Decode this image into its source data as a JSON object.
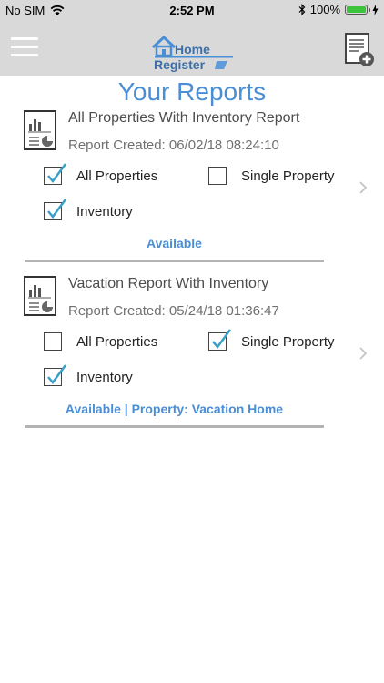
{
  "status_bar": {
    "carrier": "No SIM",
    "time": "2:52 PM",
    "battery_percent": "100%"
  },
  "header": {
    "logo_text_top": "Home",
    "logo_text_bottom": "Register",
    "logo_color": "#4a8ed6"
  },
  "page": {
    "title": "Your Reports"
  },
  "reports": [
    {
      "title": "All Properties With Inventory Report",
      "created": "Report Created: 06/02/18 08:24:10",
      "options": [
        {
          "label": "All Properties",
          "checked": true
        },
        {
          "label": "Single Property",
          "checked": false
        },
        {
          "label": "Inventory",
          "checked": true
        }
      ],
      "status": "Available"
    },
    {
      "title": "Vacation Report With Inventory",
      "created": "Report Created: 05/24/18 01:36:47",
      "options": [
        {
          "label": "All Properties",
          "checked": false
        },
        {
          "label": "Single Property",
          "checked": true
        },
        {
          "label": "Inventory",
          "checked": true
        }
      ],
      "status": "Available | Property: Vacation Home"
    }
  ],
  "colors": {
    "accent": "#4a8ed6",
    "header_bg": "#d9d9d9",
    "check": "#3aa0c8"
  }
}
